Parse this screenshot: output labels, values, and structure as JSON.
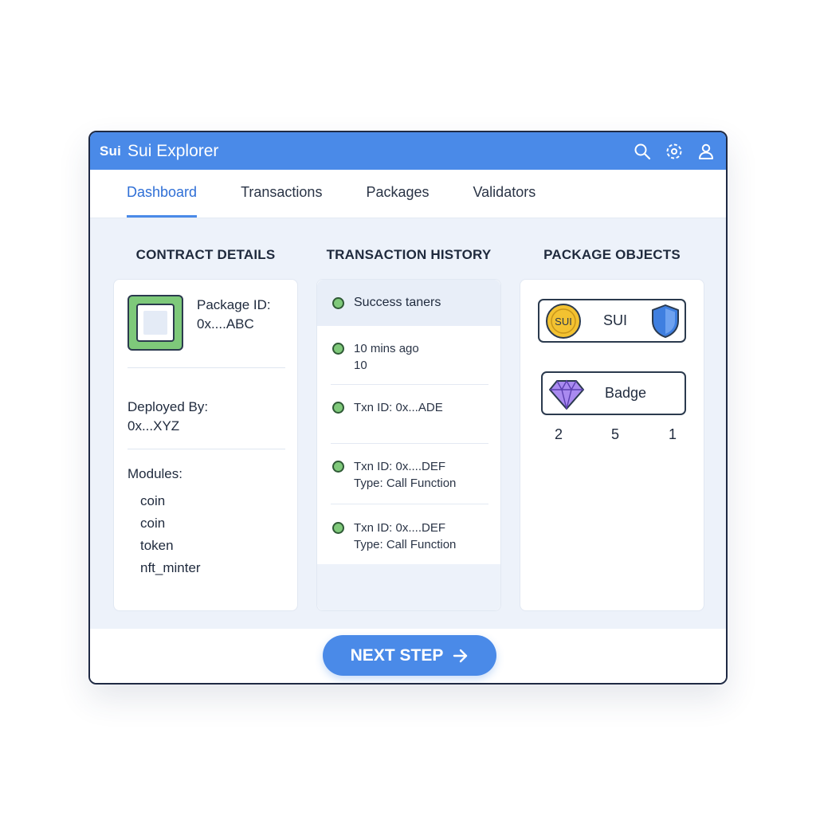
{
  "app": {
    "logo": "Sui",
    "title": "Sui Explorer"
  },
  "header_icons": [
    "search-icon",
    "settings-icon",
    "user-icon"
  ],
  "tabs": [
    {
      "label": "Dashboard",
      "active": true
    },
    {
      "label": "Transactions",
      "active": false
    },
    {
      "label": "Packages",
      "active": false
    },
    {
      "label": "Validators",
      "active": false
    }
  ],
  "contract": {
    "title": "CONTRACT DETAILS",
    "package_label": "Package ID:",
    "package_value": "0x....ABC",
    "deployed_label": "Deployed By:",
    "deployed_value": "0x...XYZ",
    "modules_label": "Modules:",
    "modules": [
      "coin",
      "coin",
      "token",
      "nft_minter"
    ]
  },
  "history": {
    "title": "TRANSACTION HISTORY",
    "head": "Success taners",
    "items": [
      {
        "line1": "10 mins ago",
        "line2": "10"
      },
      {
        "line1": "Txn ID: 0x...ADE",
        "line2": ""
      },
      {
        "line1": "Txn ID: 0x....DEF",
        "line2": "Type: Call Function"
      },
      {
        "line1": "Txn ID: 0x....DEF",
        "line2": "Type: Call Function"
      }
    ]
  },
  "objects": {
    "title": "PACKAGE OBJECTS",
    "sui_chip": {
      "coin_text": "SUI",
      "label": "SUI"
    },
    "badge_chip": {
      "label": "Badge"
    },
    "counts": [
      "2",
      "5",
      "1"
    ]
  },
  "footer": {
    "next_label": "NEXT STEP"
  },
  "colors": {
    "accent": "#4a8ae8",
    "status_green": "#7fc97a",
    "gem_purple": "#a98af0",
    "coin_gold": "#f3c231",
    "shield_blue": "#3f7fe0"
  }
}
